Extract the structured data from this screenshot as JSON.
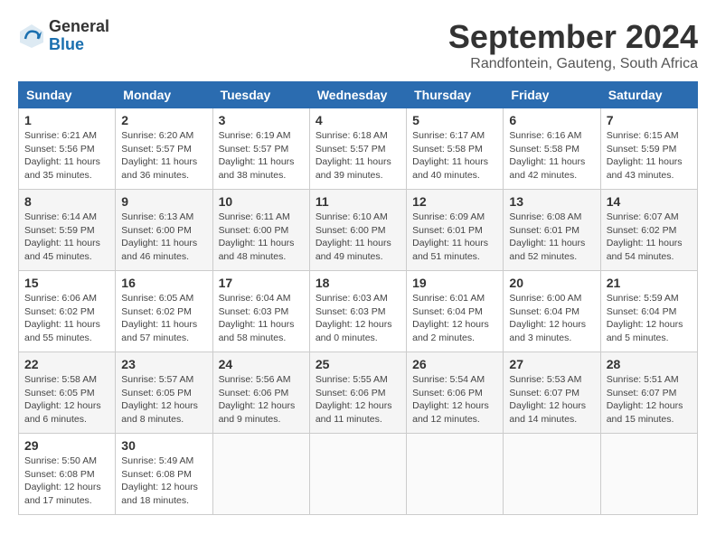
{
  "header": {
    "logo_general": "General",
    "logo_blue": "Blue",
    "month_title": "September 2024",
    "location": "Randfontein, Gauteng, South Africa"
  },
  "weekdays": [
    "Sunday",
    "Monday",
    "Tuesday",
    "Wednesday",
    "Thursday",
    "Friday",
    "Saturday"
  ],
  "weeks": [
    [
      {
        "day": "1",
        "sunrise": "Sunrise: 6:21 AM",
        "sunset": "Sunset: 5:56 PM",
        "daylight": "Daylight: 11 hours and 35 minutes."
      },
      {
        "day": "2",
        "sunrise": "Sunrise: 6:20 AM",
        "sunset": "Sunset: 5:57 PM",
        "daylight": "Daylight: 11 hours and 36 minutes."
      },
      {
        "day": "3",
        "sunrise": "Sunrise: 6:19 AM",
        "sunset": "Sunset: 5:57 PM",
        "daylight": "Daylight: 11 hours and 38 minutes."
      },
      {
        "day": "4",
        "sunrise": "Sunrise: 6:18 AM",
        "sunset": "Sunset: 5:57 PM",
        "daylight": "Daylight: 11 hours and 39 minutes."
      },
      {
        "day": "5",
        "sunrise": "Sunrise: 6:17 AM",
        "sunset": "Sunset: 5:58 PM",
        "daylight": "Daylight: 11 hours and 40 minutes."
      },
      {
        "day": "6",
        "sunrise": "Sunrise: 6:16 AM",
        "sunset": "Sunset: 5:58 PM",
        "daylight": "Daylight: 11 hours and 42 minutes."
      },
      {
        "day": "7",
        "sunrise": "Sunrise: 6:15 AM",
        "sunset": "Sunset: 5:59 PM",
        "daylight": "Daylight: 11 hours and 43 minutes."
      }
    ],
    [
      {
        "day": "8",
        "sunrise": "Sunrise: 6:14 AM",
        "sunset": "Sunset: 5:59 PM",
        "daylight": "Daylight: 11 hours and 45 minutes."
      },
      {
        "day": "9",
        "sunrise": "Sunrise: 6:13 AM",
        "sunset": "Sunset: 6:00 PM",
        "daylight": "Daylight: 11 hours and 46 minutes."
      },
      {
        "day": "10",
        "sunrise": "Sunrise: 6:11 AM",
        "sunset": "Sunset: 6:00 PM",
        "daylight": "Daylight: 11 hours and 48 minutes."
      },
      {
        "day": "11",
        "sunrise": "Sunrise: 6:10 AM",
        "sunset": "Sunset: 6:00 PM",
        "daylight": "Daylight: 11 hours and 49 minutes."
      },
      {
        "day": "12",
        "sunrise": "Sunrise: 6:09 AM",
        "sunset": "Sunset: 6:01 PM",
        "daylight": "Daylight: 11 hours and 51 minutes."
      },
      {
        "day": "13",
        "sunrise": "Sunrise: 6:08 AM",
        "sunset": "Sunset: 6:01 PM",
        "daylight": "Daylight: 11 hours and 52 minutes."
      },
      {
        "day": "14",
        "sunrise": "Sunrise: 6:07 AM",
        "sunset": "Sunset: 6:02 PM",
        "daylight": "Daylight: 11 hours and 54 minutes."
      }
    ],
    [
      {
        "day": "15",
        "sunrise": "Sunrise: 6:06 AM",
        "sunset": "Sunset: 6:02 PM",
        "daylight": "Daylight: 11 hours and 55 minutes."
      },
      {
        "day": "16",
        "sunrise": "Sunrise: 6:05 AM",
        "sunset": "Sunset: 6:02 PM",
        "daylight": "Daylight: 11 hours and 57 minutes."
      },
      {
        "day": "17",
        "sunrise": "Sunrise: 6:04 AM",
        "sunset": "Sunset: 6:03 PM",
        "daylight": "Daylight: 11 hours and 58 minutes."
      },
      {
        "day": "18",
        "sunrise": "Sunrise: 6:03 AM",
        "sunset": "Sunset: 6:03 PM",
        "daylight": "Daylight: 12 hours and 0 minutes."
      },
      {
        "day": "19",
        "sunrise": "Sunrise: 6:01 AM",
        "sunset": "Sunset: 6:04 PM",
        "daylight": "Daylight: 12 hours and 2 minutes."
      },
      {
        "day": "20",
        "sunrise": "Sunrise: 6:00 AM",
        "sunset": "Sunset: 6:04 PM",
        "daylight": "Daylight: 12 hours and 3 minutes."
      },
      {
        "day": "21",
        "sunrise": "Sunrise: 5:59 AM",
        "sunset": "Sunset: 6:04 PM",
        "daylight": "Daylight: 12 hours and 5 minutes."
      }
    ],
    [
      {
        "day": "22",
        "sunrise": "Sunrise: 5:58 AM",
        "sunset": "Sunset: 6:05 PM",
        "daylight": "Daylight: 12 hours and 6 minutes."
      },
      {
        "day": "23",
        "sunrise": "Sunrise: 5:57 AM",
        "sunset": "Sunset: 6:05 PM",
        "daylight": "Daylight: 12 hours and 8 minutes."
      },
      {
        "day": "24",
        "sunrise": "Sunrise: 5:56 AM",
        "sunset": "Sunset: 6:06 PM",
        "daylight": "Daylight: 12 hours and 9 minutes."
      },
      {
        "day": "25",
        "sunrise": "Sunrise: 5:55 AM",
        "sunset": "Sunset: 6:06 PM",
        "daylight": "Daylight: 12 hours and 11 minutes."
      },
      {
        "day": "26",
        "sunrise": "Sunrise: 5:54 AM",
        "sunset": "Sunset: 6:06 PM",
        "daylight": "Daylight: 12 hours and 12 minutes."
      },
      {
        "day": "27",
        "sunrise": "Sunrise: 5:53 AM",
        "sunset": "Sunset: 6:07 PM",
        "daylight": "Daylight: 12 hours and 14 minutes."
      },
      {
        "day": "28",
        "sunrise": "Sunrise: 5:51 AM",
        "sunset": "Sunset: 6:07 PM",
        "daylight": "Daylight: 12 hours and 15 minutes."
      }
    ],
    [
      {
        "day": "29",
        "sunrise": "Sunrise: 5:50 AM",
        "sunset": "Sunset: 6:08 PM",
        "daylight": "Daylight: 12 hours and 17 minutes."
      },
      {
        "day": "30",
        "sunrise": "Sunrise: 5:49 AM",
        "sunset": "Sunset: 6:08 PM",
        "daylight": "Daylight: 12 hours and 18 minutes."
      },
      null,
      null,
      null,
      null,
      null
    ]
  ]
}
